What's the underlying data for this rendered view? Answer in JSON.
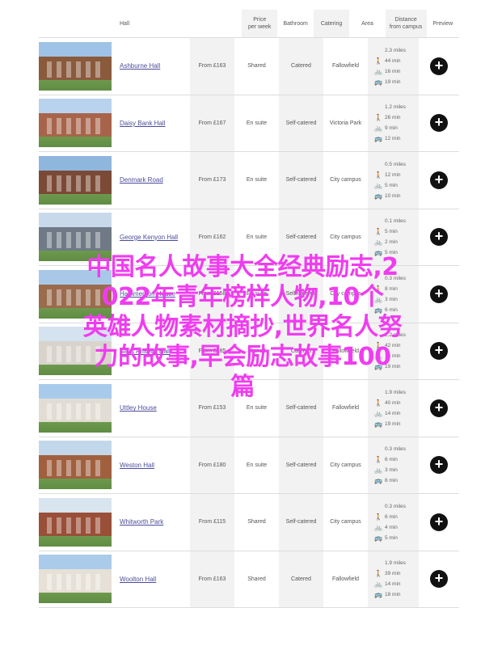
{
  "headers": {
    "hall": "Hall",
    "price_line1": "Price",
    "price_line2": "per week",
    "bathroom": "Bathroom",
    "catering": "Catering",
    "area": "Area",
    "distance_line1": "Distance",
    "distance_line2": "from campus",
    "preview": "Preview"
  },
  "rows": [
    {
      "hall": "Ashburne Hall",
      "price": "From £163",
      "bathroom": "Shared",
      "catering": "Catered",
      "area": "Fallowfield",
      "miles": "2.3 miles",
      "walk": "44 min",
      "bike": "16 min",
      "bus": "19 min"
    },
    {
      "hall": "Daisy Bank Hall",
      "price": "From £167",
      "bathroom": "En suite",
      "catering": "Self-catered",
      "area": "Victoria Park",
      "miles": "1.2 miles",
      "walk": "26 min",
      "bike": "9 min",
      "bus": "12 min"
    },
    {
      "hall": "Denmark Road",
      "price": "From £173",
      "bathroom": "En suite",
      "catering": "Self-catered",
      "area": "City campus",
      "miles": "0.5 miles",
      "walk": "12 min",
      "bike": "5 min",
      "bus": "10 min"
    },
    {
      "hall": "George Kenyon Hall",
      "price": "From £162",
      "bathroom": "En suite",
      "catering": "Self-catered",
      "area": "City campus",
      "miles": "0.1 miles",
      "walk": "5 min",
      "bike": "2 min",
      "bus": "5 min"
    },
    {
      "hall": "Hammerson House",
      "price": "From £158",
      "bathroom": "En suite",
      "catering": "Self-catered",
      "area": "City campus",
      "miles": "0.3 miles",
      "walk": "8 min",
      "bike": "3 min",
      "bus": "6 min"
    },
    {
      "hall": "Saint Anselm Hall",
      "price": "From £185",
      "bathroom": "Shared",
      "catering": "Catered",
      "area": "Fallowfield",
      "miles": "2.2 miles",
      "walk": "42 min",
      "bike": "16 min",
      "bus": "19 min"
    },
    {
      "hall": "Uttley House",
      "price": "From £153",
      "bathroom": "En suite",
      "catering": "Self-catered",
      "area": "Fallowfield",
      "miles": "1.9 miles",
      "walk": "40 min",
      "bike": "14 min",
      "bus": "19 min"
    },
    {
      "hall": "Weston Hall",
      "price": "From £180",
      "bathroom": "En suite",
      "catering": "Self-catered",
      "area": "City campus",
      "miles": "0.3 miles",
      "walk": "6 min",
      "bike": "3 min",
      "bus": "8 min"
    },
    {
      "hall": "Whitworth Park",
      "price": "From £115",
      "bathroom": "Shared",
      "catering": "Self-catered",
      "area": "City campus",
      "miles": "0.3 miles",
      "walk": "6 min",
      "bike": "4 min",
      "bus": "5 min"
    },
    {
      "hall": "Woolton Hall",
      "price": "From £163",
      "bathroom": "Shared",
      "catering": "Catered",
      "area": "Fallowfield",
      "miles": "1.9 miles",
      "walk": "39 min",
      "bike": "14 min",
      "bus": "18 min"
    }
  ],
  "preview_label": "+",
  "overlay": {
    "line1": "中国名人故事大全经典励志,2",
    "line2": "022年青年榜样人物,10个",
    "line3": "英雄人物素材摘抄,世界名人努",
    "line4": "力的故事,早会励志故事100",
    "line5": "篇"
  },
  "colors": {
    "link": "#4b4c9a",
    "overlay": "#f03cf0",
    "shade": "#f2f2f2"
  }
}
